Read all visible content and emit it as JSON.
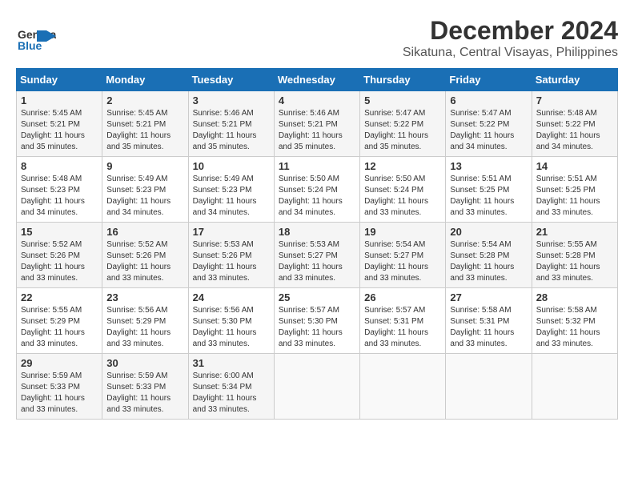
{
  "logo": {
    "name_part1": "General",
    "name_part2": "Blue"
  },
  "title": "December 2024",
  "subtitle": "Sikatuna, Central Visayas, Philippines",
  "days_of_week": [
    "Sunday",
    "Monday",
    "Tuesday",
    "Wednesday",
    "Thursday",
    "Friday",
    "Saturday"
  ],
  "weeks": [
    [
      {
        "day": "1",
        "sunrise": "5:45 AM",
        "sunset": "5:21 PM",
        "daylight": "11 hours and 35 minutes."
      },
      {
        "day": "2",
        "sunrise": "5:45 AM",
        "sunset": "5:21 PM",
        "daylight": "11 hours and 35 minutes."
      },
      {
        "day": "3",
        "sunrise": "5:46 AM",
        "sunset": "5:21 PM",
        "daylight": "11 hours and 35 minutes."
      },
      {
        "day": "4",
        "sunrise": "5:46 AM",
        "sunset": "5:21 PM",
        "daylight": "11 hours and 35 minutes."
      },
      {
        "day": "5",
        "sunrise": "5:47 AM",
        "sunset": "5:22 PM",
        "daylight": "11 hours and 35 minutes."
      },
      {
        "day": "6",
        "sunrise": "5:47 AM",
        "sunset": "5:22 PM",
        "daylight": "11 hours and 34 minutes."
      },
      {
        "day": "7",
        "sunrise": "5:48 AM",
        "sunset": "5:22 PM",
        "daylight": "11 hours and 34 minutes."
      }
    ],
    [
      {
        "day": "8",
        "sunrise": "5:48 AM",
        "sunset": "5:23 PM",
        "daylight": "11 hours and 34 minutes."
      },
      {
        "day": "9",
        "sunrise": "5:49 AM",
        "sunset": "5:23 PM",
        "daylight": "11 hours and 34 minutes."
      },
      {
        "day": "10",
        "sunrise": "5:49 AM",
        "sunset": "5:23 PM",
        "daylight": "11 hours and 34 minutes."
      },
      {
        "day": "11",
        "sunrise": "5:50 AM",
        "sunset": "5:24 PM",
        "daylight": "11 hours and 34 minutes."
      },
      {
        "day": "12",
        "sunrise": "5:50 AM",
        "sunset": "5:24 PM",
        "daylight": "11 hours and 33 minutes."
      },
      {
        "day": "13",
        "sunrise": "5:51 AM",
        "sunset": "5:25 PM",
        "daylight": "11 hours and 33 minutes."
      },
      {
        "day": "14",
        "sunrise": "5:51 AM",
        "sunset": "5:25 PM",
        "daylight": "11 hours and 33 minutes."
      }
    ],
    [
      {
        "day": "15",
        "sunrise": "5:52 AM",
        "sunset": "5:26 PM",
        "daylight": "11 hours and 33 minutes."
      },
      {
        "day": "16",
        "sunrise": "5:52 AM",
        "sunset": "5:26 PM",
        "daylight": "11 hours and 33 minutes."
      },
      {
        "day": "17",
        "sunrise": "5:53 AM",
        "sunset": "5:26 PM",
        "daylight": "11 hours and 33 minutes."
      },
      {
        "day": "18",
        "sunrise": "5:53 AM",
        "sunset": "5:27 PM",
        "daylight": "11 hours and 33 minutes."
      },
      {
        "day": "19",
        "sunrise": "5:54 AM",
        "sunset": "5:27 PM",
        "daylight": "11 hours and 33 minutes."
      },
      {
        "day": "20",
        "sunrise": "5:54 AM",
        "sunset": "5:28 PM",
        "daylight": "11 hours and 33 minutes."
      },
      {
        "day": "21",
        "sunrise": "5:55 AM",
        "sunset": "5:28 PM",
        "daylight": "11 hours and 33 minutes."
      }
    ],
    [
      {
        "day": "22",
        "sunrise": "5:55 AM",
        "sunset": "5:29 PM",
        "daylight": "11 hours and 33 minutes."
      },
      {
        "day": "23",
        "sunrise": "5:56 AM",
        "sunset": "5:29 PM",
        "daylight": "11 hours and 33 minutes."
      },
      {
        "day": "24",
        "sunrise": "5:56 AM",
        "sunset": "5:30 PM",
        "daylight": "11 hours and 33 minutes."
      },
      {
        "day": "25",
        "sunrise": "5:57 AM",
        "sunset": "5:30 PM",
        "daylight": "11 hours and 33 minutes."
      },
      {
        "day": "26",
        "sunrise": "5:57 AM",
        "sunset": "5:31 PM",
        "daylight": "11 hours and 33 minutes."
      },
      {
        "day": "27",
        "sunrise": "5:58 AM",
        "sunset": "5:31 PM",
        "daylight": "11 hours and 33 minutes."
      },
      {
        "day": "28",
        "sunrise": "5:58 AM",
        "sunset": "5:32 PM",
        "daylight": "11 hours and 33 minutes."
      }
    ],
    [
      {
        "day": "29",
        "sunrise": "5:59 AM",
        "sunset": "5:33 PM",
        "daylight": "11 hours and 33 minutes."
      },
      {
        "day": "30",
        "sunrise": "5:59 AM",
        "sunset": "5:33 PM",
        "daylight": "11 hours and 33 minutes."
      },
      {
        "day": "31",
        "sunrise": "6:00 AM",
        "sunset": "5:34 PM",
        "daylight": "11 hours and 33 minutes."
      },
      null,
      null,
      null,
      null
    ]
  ]
}
